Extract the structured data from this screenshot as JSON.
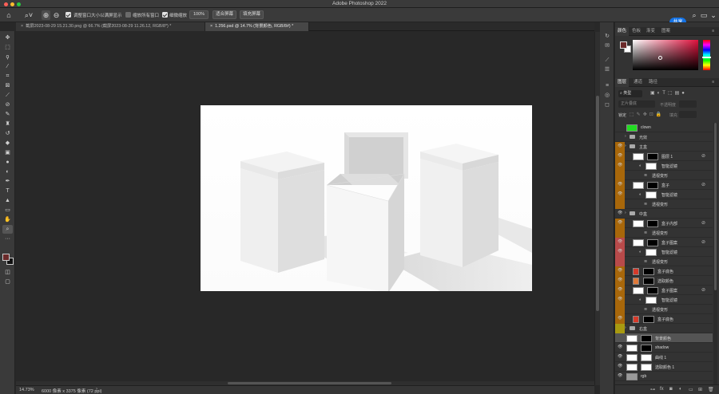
{
  "app_title": "Adobe Photoshop 2022",
  "options_bar": {
    "resize_windows_label": "调整窗口大小以满屏显示",
    "zoom_all_label": "缩放所有窗口",
    "scrubby_zoom_label": "细微缩放",
    "zoom_value": "100%",
    "fit_screen_label": "适合屏幕",
    "fill_screen_label": "填充屏幕",
    "share_label": "共享"
  },
  "tabs": [
    {
      "label": "截屏2023-08-29 15.21.30.png @ 66.7% (截屏2023-08-29 11.26.12, RGB/8*) *"
    },
    {
      "label": "1.256.psd @ 14.7% (背景颜色, RGB/8#) *"
    }
  ],
  "status_bar": {
    "zoom": "14.73%",
    "doc_size": "6000 像素 x 3375 像素 (72 ppi)"
  },
  "color_panel": {
    "tabs": [
      "颜色",
      "色板",
      "渐变",
      "图案"
    ],
    "foreground": "#6b2a2a",
    "background": "#ffffff",
    "hue_color": "#e0113d"
  },
  "layers_panel": {
    "tabs": [
      "图层",
      "通道",
      "路径"
    ],
    "filter_kind": "类型",
    "blend_mode": "正片叠底",
    "opacity_label": "不透明度",
    "lock_label": "锁定",
    "fill_label": "填充",
    "layers": [
      {
        "name": "clown",
        "type": "layer",
        "eye": false,
        "tag": "",
        "thumb": "#22dd22"
      },
      {
        "name": "光效",
        "type": "group",
        "eye": false,
        "tag": ""
      },
      {
        "name": "主盒",
        "type": "group",
        "eye": true,
        "tag": "#a8670a"
      },
      {
        "name": "图层 1",
        "type": "smart",
        "eye": true,
        "tag": "#a8670a"
      },
      {
        "name": "智能滤镜",
        "type": "filter",
        "eye": true,
        "tag": "#a8670a"
      },
      {
        "name": "透视变形",
        "type": "fx",
        "eye": false,
        "tag": "#a8670a"
      },
      {
        "name": "盒子",
        "type": "smart",
        "eye": true,
        "tag": "#a8670a"
      },
      {
        "name": "智能滤镜",
        "type": "filter",
        "eye": true,
        "tag": "#a8670a"
      },
      {
        "name": "透视变形",
        "type": "fx",
        "eye": false,
        "tag": "#a8670a"
      },
      {
        "name": "中盒",
        "type": "group",
        "eye": true,
        "tag": ""
      },
      {
        "name": "盒子内部",
        "type": "smart",
        "eye": true,
        "tag": "#a8670a"
      },
      {
        "name": "透视变形",
        "type": "fx",
        "eye": false,
        "tag": "#a8670a"
      },
      {
        "name": "盒子图案",
        "type": "smart",
        "eye": true,
        "tag": "#b84a4a"
      },
      {
        "name": "智能滤镜",
        "type": "filter",
        "eye": true,
        "tag": "#b84a4a"
      },
      {
        "name": "透视变形",
        "type": "fx",
        "eye": false,
        "tag": "#b84a4a"
      },
      {
        "name": "盒子底色",
        "type": "color",
        "eye": true,
        "tag": "#a8670a",
        "swatch": "#d63a2a"
      },
      {
        "name": "选取颜色",
        "type": "color",
        "eye": true,
        "tag": "#a8670a",
        "swatch": "#e07a3a"
      },
      {
        "name": "盒子图案",
        "type": "smart",
        "eye": true,
        "tag": "#a8670a"
      },
      {
        "name": "智能滤镜",
        "type": "filter",
        "eye": true,
        "tag": "#a8670a"
      },
      {
        "name": "透视变形",
        "type": "fx",
        "eye": false,
        "tag": "#a8670a"
      },
      {
        "name": "盒子底色",
        "type": "color",
        "eye": true,
        "tag": "#a8670a",
        "swatch": "#d63a2a"
      },
      {
        "name": "右盒",
        "type": "group",
        "eye": false,
        "tag": "#a89a10"
      },
      {
        "name": "背景颜色",
        "type": "mask",
        "eye": false,
        "tag": "",
        "selected": true
      },
      {
        "name": "shadow",
        "type": "mask",
        "eye": true,
        "tag": ""
      },
      {
        "name": "曲线 1",
        "type": "adj",
        "eye": true,
        "tag": ""
      },
      {
        "name": "选取颜色 1",
        "type": "adj",
        "eye": true,
        "tag": ""
      },
      {
        "name": "rgb",
        "type": "layer",
        "eye": true,
        "tag": "",
        "thumb": "#9a9a9a"
      }
    ]
  }
}
